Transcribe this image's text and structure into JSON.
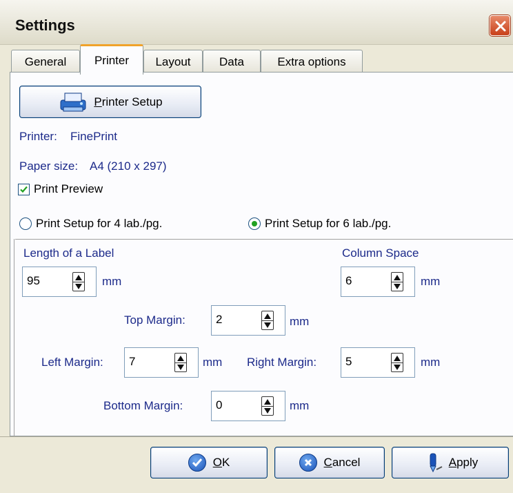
{
  "window": {
    "title": "Settings"
  },
  "tabs": [
    {
      "label": "General"
    },
    {
      "label": "Printer"
    },
    {
      "label": "Layout"
    },
    {
      "label": "Data"
    },
    {
      "label": "Extra options"
    }
  ],
  "printer": {
    "setup_button": {
      "label_first": "P",
      "label_rest": "rinter Setup"
    },
    "printer_label": "Printer:",
    "printer_value": "FinePrint",
    "paper_label": "Paper size:",
    "paper_value": "A4 (210 x 297)",
    "print_preview": {
      "label": "Print Preview",
      "checked": true
    },
    "radio_4": {
      "label": "Print Setup for 4 lab./pg.",
      "selected": false
    },
    "radio_6": {
      "label": "Print Setup for 6 lab./pg.",
      "selected": true
    }
  },
  "fields": {
    "length_label": "Length of a Label",
    "length_value": "95",
    "column_space_label": "Column Space",
    "column_space_value": "6",
    "top_margin_label": "Top Margin:",
    "top_margin_value": "2",
    "left_margin_label": "Left Margin:",
    "left_margin_value": "7",
    "right_margin_label": "Right Margin:",
    "right_margin_value": "5",
    "bottom_margin_label": "Bottom Margin:",
    "bottom_margin_value": "0",
    "unit": "mm"
  },
  "footer": {
    "ok": {
      "first": "O",
      "rest": "K"
    },
    "cancel": {
      "first": "C",
      "rest": "ancel"
    },
    "apply": {
      "first": "A",
      "rest": "pply"
    }
  },
  "colors": {
    "label_blue": "#1c2a8a",
    "tab_highlight": "#f0a22a",
    "close_red": "#c8401a",
    "check_green": "#21a121"
  }
}
